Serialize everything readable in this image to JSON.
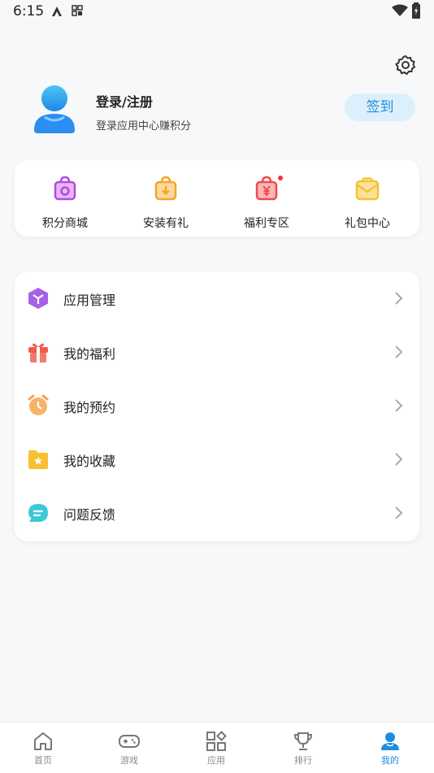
{
  "status_bar": {
    "time": "6:15"
  },
  "header": {
    "settings_icon": "gear-icon"
  },
  "profile": {
    "title": "登录/注册",
    "subtitle": "登录应用中心赚积分",
    "checkin_label": "签到",
    "avatar_icon": "user-avatar-icon"
  },
  "quick_actions": [
    {
      "label": "积分商城",
      "icon": "shopping-bag-icon",
      "color": "#b24be0"
    },
    {
      "label": "安装有礼",
      "icon": "install-bag-icon",
      "color": "#f5a623"
    },
    {
      "label": "福利专区",
      "icon": "yuan-bag-icon",
      "color": "#f04a4a"
    },
    {
      "label": "礼包中心",
      "icon": "gift-envelope-icon",
      "color": "#f7c12f"
    }
  ],
  "menu": [
    {
      "label": "应用管理",
      "icon": "cube-icon",
      "color": "#a860e8"
    },
    {
      "label": "我的福利",
      "icon": "gift-icon",
      "color": "#f05a4a"
    },
    {
      "label": "我的预约",
      "icon": "alarm-clock-icon",
      "color": "#f5a04a"
    },
    {
      "label": "我的收藏",
      "icon": "star-folder-icon",
      "color": "#f7c12f"
    },
    {
      "label": "问题反馈",
      "icon": "chat-bubble-icon",
      "color": "#3cc8d8"
    }
  ],
  "tabs": [
    {
      "label": "首页",
      "icon": "home-icon",
      "active": false
    },
    {
      "label": "游戏",
      "icon": "gamepad-icon",
      "active": false
    },
    {
      "label": "应用",
      "icon": "apps-grid-icon",
      "active": false
    },
    {
      "label": "排行",
      "icon": "trophy-icon",
      "active": false
    },
    {
      "label": "我的",
      "icon": "profile-icon",
      "active": true
    }
  ],
  "colors": {
    "accent": "#1c8fe3",
    "checkin_bg": "#dcf0fb"
  }
}
